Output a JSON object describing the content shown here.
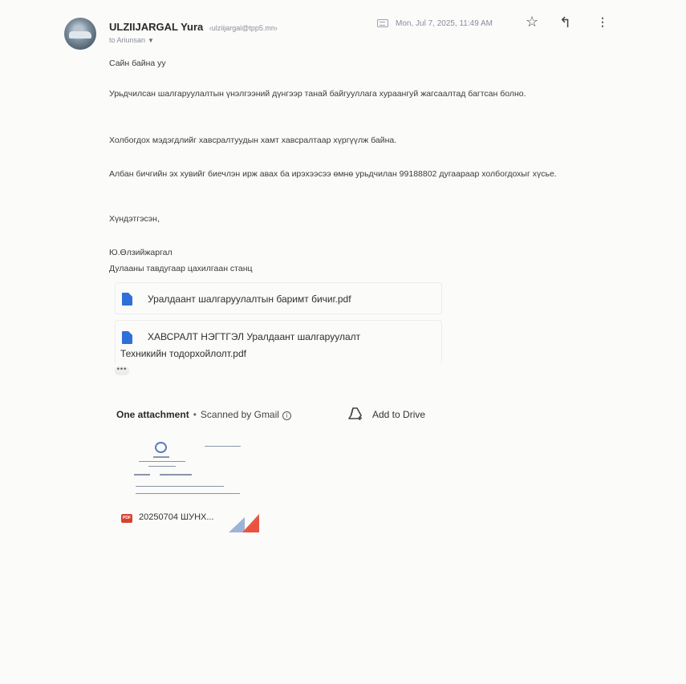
{
  "header": {
    "sender_name": "ULZIIJARGAL Yura",
    "sender_email": "‹ulziijargal@tpp5.mn›",
    "to_line": "to Ariunsan",
    "date": "Mon, Jul 7, 2025, 11:49 AM"
  },
  "icons": {
    "label": "label-icon",
    "star": "star-icon",
    "reply": "reply-icon",
    "more": "more-vert-icon",
    "drive": "add-to-drive-icon",
    "info": "info-icon"
  },
  "message": {
    "greeting": "Сайн байна уу",
    "para1": "Урьдчилсан шалгаруулалтын үнэлгээний дүнгээр танай байгууллага хураангуй жагсаалтад багтсан болно.",
    "para2": "Холбогдох мэдэгдлийг хавсралтуудын хамт хавсралтаар хүргүүлж байна.",
    "para3": "Албан бичгийн эх хувийг биечлэн ирж авах ба ирэхээсээ өмнө урьдчилан 99188802 дугаараар холбогдохыг хүсье.",
    "closing": "Хүндэтгэсэн,",
    "signature_name": "Ю.Өлзийжаргал",
    "signature_org": "Дулааны тавдугаар цахилгаан станц"
  },
  "docs": [
    {
      "title": "Уралдаант шалгаруулалтын баримт бичиг.pdf"
    },
    {
      "title_line1": "ХАВСРАЛТ НЭГТГЭЛ Уралдаант шалгаруулалт",
      "title_line2": "Техникийн тодорхойлолт.pdf"
    }
  ],
  "ellipsis": "•••",
  "attachments": {
    "count_label": "One attachment",
    "separator": "•",
    "scanned_label": "Scanned by Gmail",
    "info_glyph": "i",
    "add_to_drive": "Add to Drive",
    "file_badge": "PDF",
    "file_name": "20250704 ШУНХ..."
  },
  "colors": {
    "doc_icon_blue": "#2f6fd8",
    "pdf_red": "#d9412f"
  }
}
